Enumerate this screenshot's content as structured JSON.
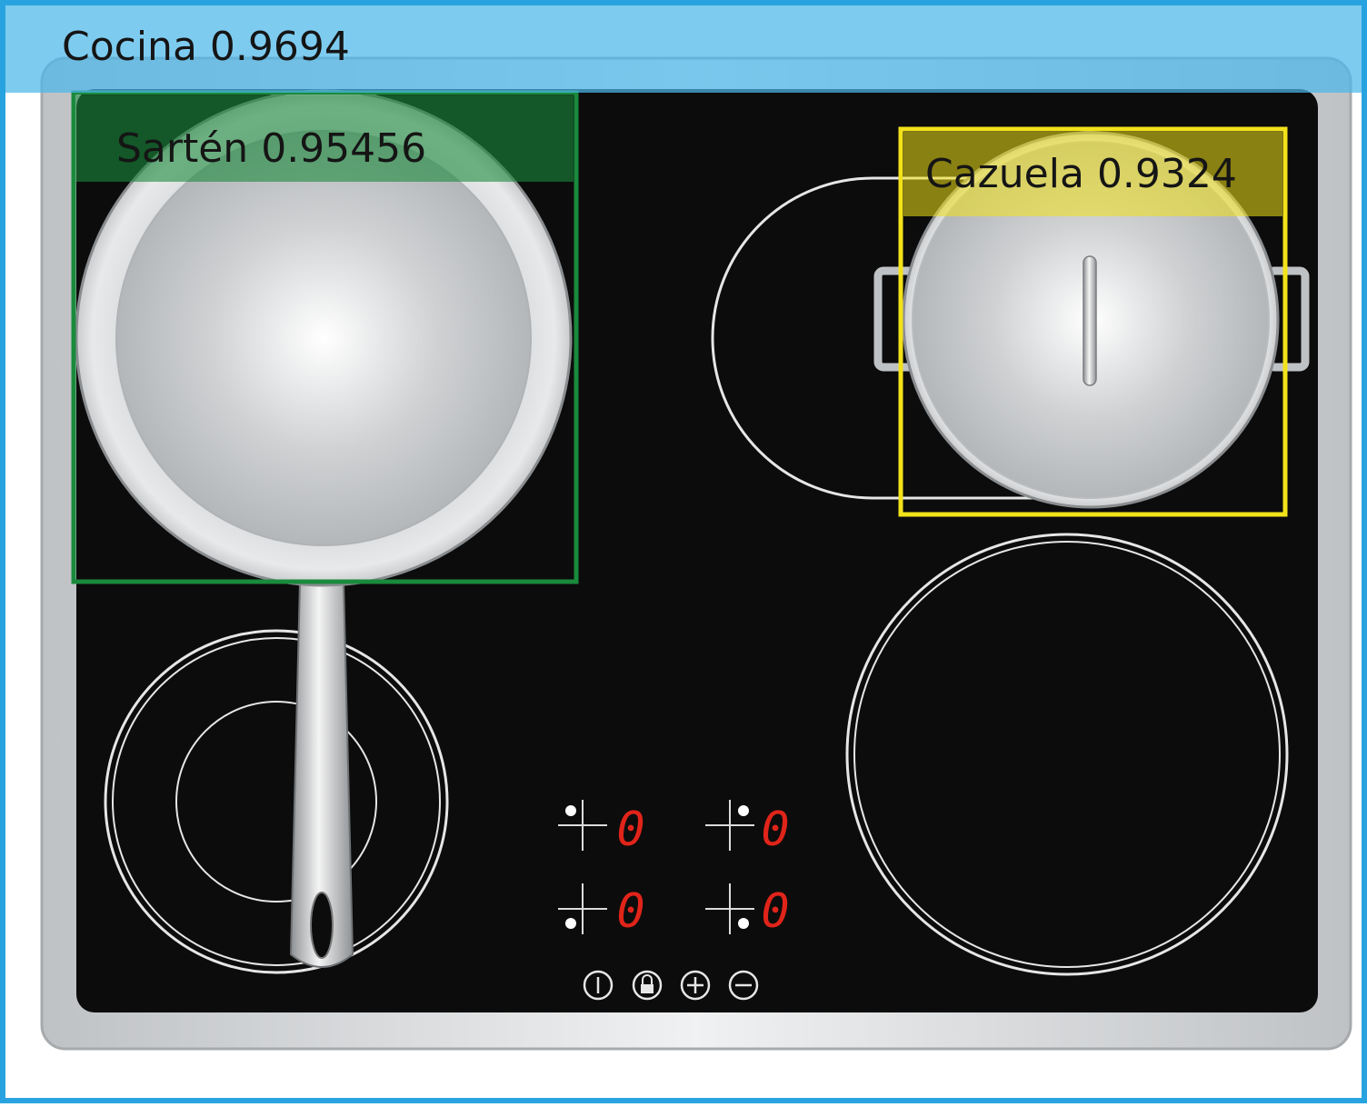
{
  "detections": {
    "kitchen": {
      "label": "Cocina",
      "score": "0.9694",
      "color": "#3aaee8"
    },
    "pan": {
      "label": "Sartén",
      "score": "0.95456",
      "color": "#1a8a3c"
    },
    "pot": {
      "label": "Cazuela",
      "score": "0.9324",
      "color": "#f2e21a"
    }
  },
  "cooktop": {
    "display_digits": [
      "0",
      "0",
      "0",
      "0"
    ],
    "button_icons": [
      "power-icon",
      "lock-icon",
      "plus-icon",
      "minus-icon"
    ],
    "display_color": "#e0241a"
  },
  "colors": {
    "glass": "#0c0c0c",
    "frame": "#d9dcde",
    "steel": "#c9ccce"
  }
}
